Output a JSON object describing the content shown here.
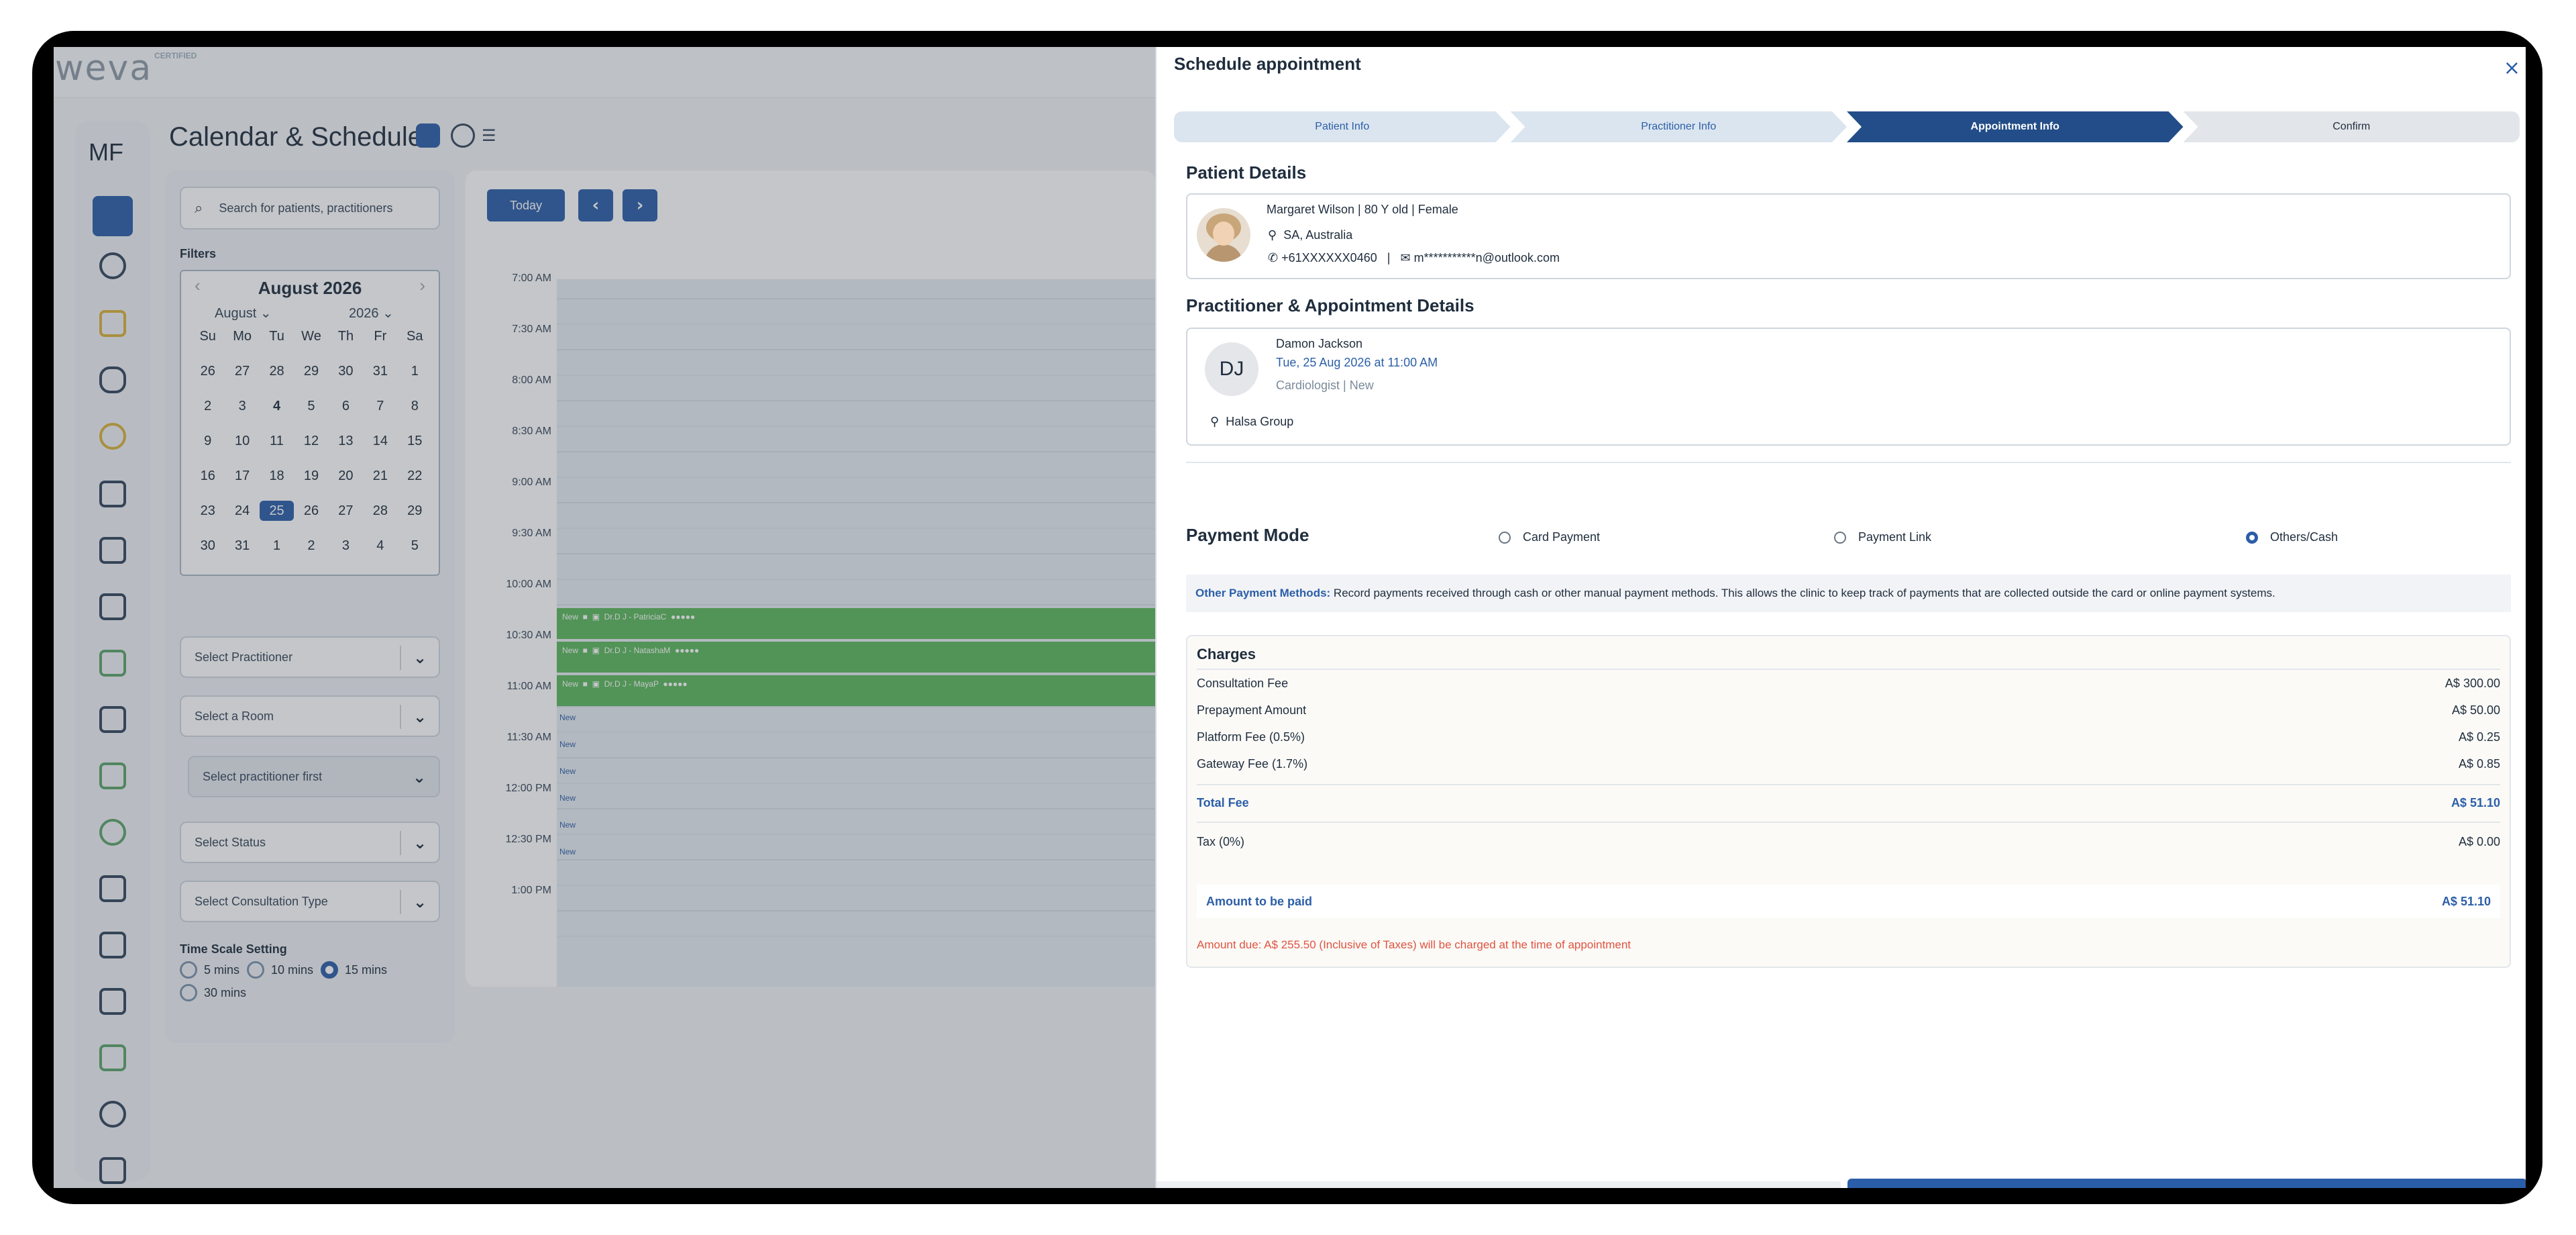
{
  "app": {
    "logo": "weva",
    "logo_badge": "CERTIFIED",
    "user_initials": "MF",
    "page_title": "Calendar & Schedule"
  },
  "filters": {
    "search_placeholder": "Search for patients, practitioners",
    "label": "Filters",
    "calendar": {
      "title": "August 2026",
      "month_select": "August",
      "year_select": "2026",
      "weekdays": [
        "Su",
        "Mo",
        "Tu",
        "We",
        "Th",
        "Fr",
        "Sa"
      ],
      "days": [
        "26",
        "27",
        "28",
        "29",
        "30",
        "31",
        "1",
        "2",
        "3",
        "4",
        "5",
        "6",
        "7",
        "8",
        "9",
        "10",
        "11",
        "12",
        "13",
        "14",
        "15",
        "16",
        "17",
        "18",
        "19",
        "20",
        "21",
        "22",
        "23",
        "24",
        "25",
        "26",
        "27",
        "28",
        "29",
        "30",
        "31",
        "1",
        "2",
        "3",
        "4",
        "5"
      ],
      "selected_day": "25"
    },
    "selects": [
      "Select Practitioner",
      "Select a Room",
      "Select practitioner first",
      "Select Status",
      "Select Consultation Type"
    ],
    "time_scale": {
      "label": "Time Scale Setting",
      "options": [
        "5 mins",
        "10 mins",
        "15 mins",
        "30 mins"
      ],
      "selected": "15 mins"
    }
  },
  "schedule": {
    "today_label": "Today",
    "prev_icon": "chevron-left-icon",
    "next_icon": "chevron-right-icon",
    "times": [
      "7:00 AM",
      "7:30 AM",
      "8:00 AM",
      "8:30 AM",
      "9:00 AM",
      "9:30 AM",
      "10:00 AM",
      "10:30 AM",
      "11:00 AM",
      "11:30 AM",
      "12:00 PM",
      "12:30 PM",
      "1:00 PM"
    ],
    "appointments": [
      {
        "status": "New",
        "label": "Dr.D J - PatriciaC"
      },
      {
        "status": "New",
        "label": "Dr.D J - NatashaM"
      },
      {
        "status": "New",
        "label": "Dr.D J - MayaP"
      }
    ],
    "new_tag": "New"
  },
  "drawer": {
    "title": "Schedule appointment",
    "steps": [
      "Patient Info",
      "Practitioner Info",
      "Appointment Info",
      "Confirm"
    ],
    "active_step": "Appointment Info",
    "patient_section": "Patient Details",
    "patient": {
      "summary": "Margaret Wilson | 80 Y old | Female",
      "location": "SA, Australia",
      "phone": "+61XXXXXX0460",
      "separator": "|",
      "email": "m***********n@outlook.com"
    },
    "practitioner_section": "Practitioner & Appointment Details",
    "practitioner": {
      "initials": "DJ",
      "name": "Damon Jackson",
      "datetime": "Tue, 25 Aug 2026 at 11:00 AM",
      "role": "Cardiologist | New",
      "org": "Halsa Group"
    },
    "payment_mode_label": "Payment Mode",
    "payment_options": [
      "Card Payment",
      "Payment Link",
      "Others/Cash"
    ],
    "payment_selected": "Others/Cash",
    "other_methods_label": "Other Payment Methods:",
    "other_methods_text": " Record payments received through cash or other manual payment methods. This allows the clinic to keep track of payments that are collected outside the card or online payment systems.",
    "charges": {
      "title": "Charges",
      "rows": [
        {
          "label": "Consultation Fee",
          "value": "A$ 300.00"
        },
        {
          "label": "Prepayment Amount",
          "value": "A$ 50.00"
        },
        {
          "label": "Platform Fee (0.5%)",
          "value": "A$ 0.25"
        },
        {
          "label": "Gateway Fee (1.7%)",
          "value": "A$ 0.85"
        }
      ],
      "total_label": "Total Fee",
      "total_value": "A$ 51.10",
      "tax_label": "Tax (0%)",
      "tax_value": "A$ 0.00",
      "amount_label": "Amount to be paid",
      "amount_value": "A$ 51.10",
      "due_note": "Amount due: A$ 255.50 (Inclusive of Taxes) will be charged at the time of appointment"
    },
    "close_icon": "close-icon"
  },
  "colors": {
    "accent": "#2b5ea8",
    "appointment_green": "#5cb85c",
    "due_red": "#e0533f"
  }
}
